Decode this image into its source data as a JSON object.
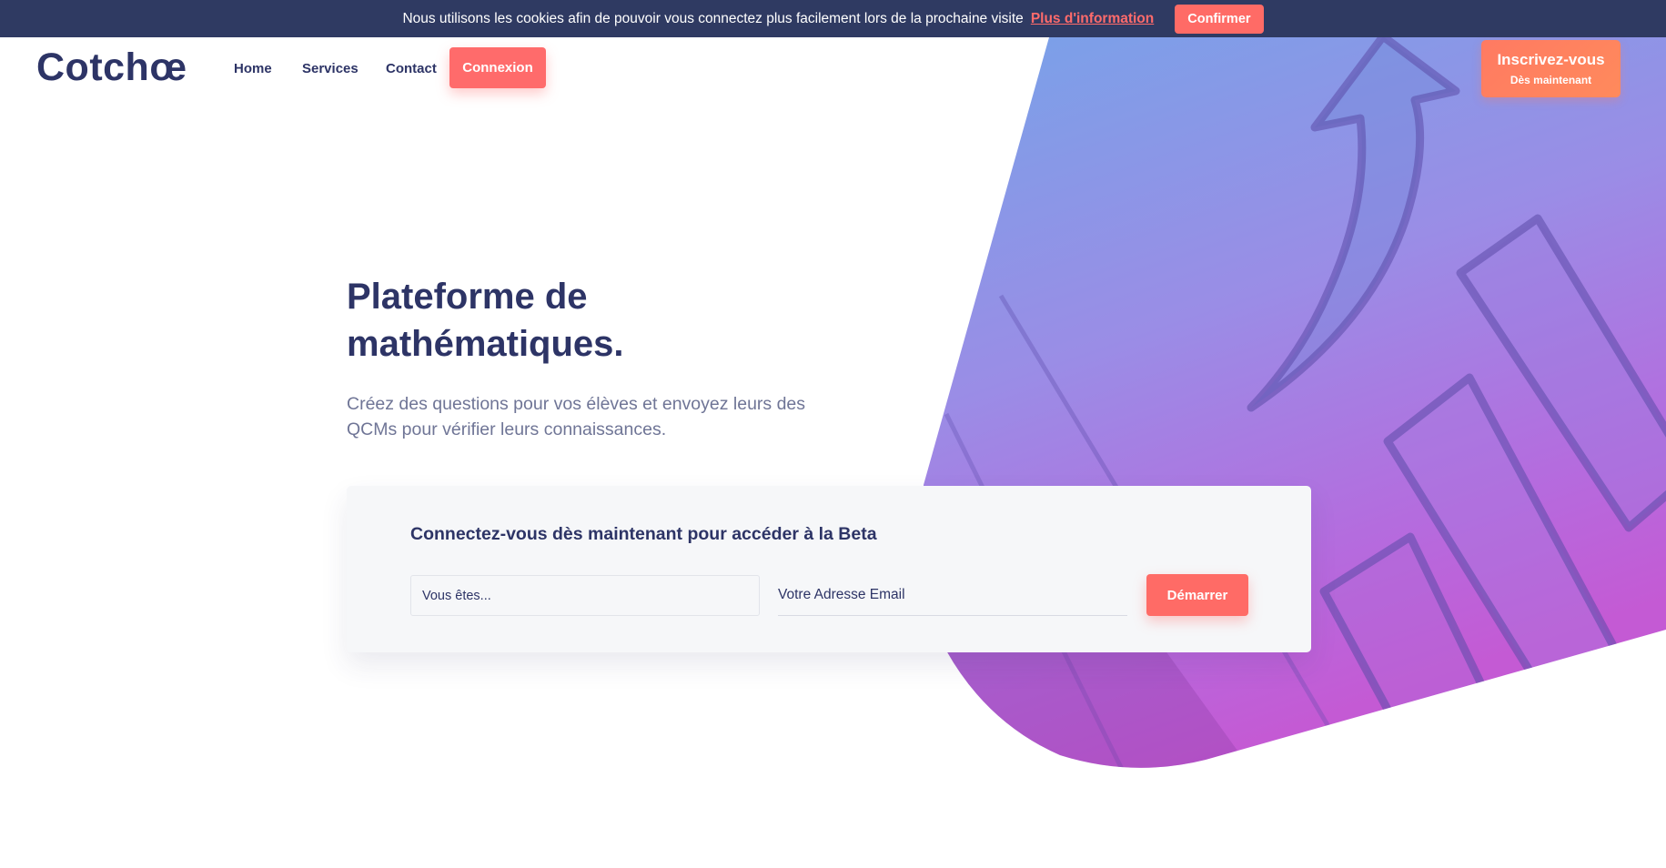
{
  "cookie_bar": {
    "message": "Nous utilisons les cookies afin de pouvoir vous connectez plus facilement lors de la prochaine visite",
    "link_label": "Plus d'information",
    "confirm_label": "Confirmer"
  },
  "header": {
    "logo_text": "Cotchœ",
    "nav": {
      "home": "Home",
      "services": "Services",
      "contact": "Contact",
      "login": "Connexion"
    },
    "signup": {
      "label": "Inscrivez-vous",
      "sublabel": "Dès maintenant"
    }
  },
  "hero": {
    "title_line1": "Plateforme de",
    "title_line2": "mathématiques.",
    "subtitle": "Créez des questions pour vos élèves et envoyez leurs des QCMs pour vérifier leurs connaissances."
  },
  "beta_form": {
    "title": "Connectez-vous dès maintenant pour accéder à la Beta",
    "role_placeholder": "Vous êtes...",
    "email_placeholder": "Votre Adresse Email",
    "submit_label": "Démarrer"
  },
  "colors": {
    "primary": "#2d3466",
    "accent": "#ff6b6b",
    "cookie_bar_bg": "#2f3a62",
    "gradient_top": "#7ea3e8",
    "gradient_bottom": "#c25fd8"
  }
}
